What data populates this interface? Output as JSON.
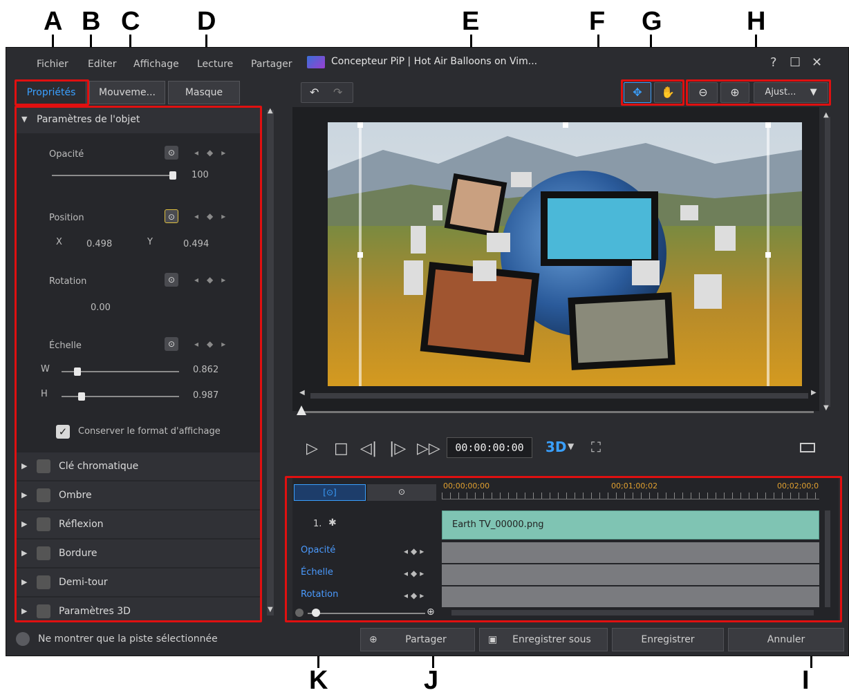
{
  "callouts": [
    "A",
    "B",
    "C",
    "D",
    "E",
    "F",
    "G",
    "H",
    "I",
    "J",
    "K"
  ],
  "menu": [
    "Fichier",
    "Editer",
    "Affichage",
    "Lecture",
    "Partager"
  ],
  "title": "Concepteur PiP | Hot Air Balloons on Vim...",
  "window_controls": {
    "help": "?",
    "maximize": "☐",
    "close": "✕"
  },
  "tabs": [
    "Propriétés",
    "Mouveme...",
    "Masque"
  ],
  "object_params": {
    "header": "Paramètres de l'objet",
    "opacity_label": "Opacité",
    "opacity_value": "100",
    "opacity_level": 100,
    "position_label": "Position",
    "x_label": "X",
    "x_value": "0.498",
    "y_label": "Y",
    "y_value": "0.494",
    "rotation_label": "Rotation",
    "rotation_value": "0.00",
    "scale_label": "Échelle",
    "w_label": "W",
    "w_value": "0.862",
    "h_label": "H",
    "h_value": "0.987",
    "keep_ratio_label": "Conserver le format d'affichage"
  },
  "sections": [
    "Clé chromatique",
    "Ombre",
    "Réflexion",
    "Bordure",
    "Demi-tour",
    "Paramètres 3D"
  ],
  "zoom_fit_label": "Ajust...",
  "timecode": "00:00:00:00",
  "view_mode": "3D",
  "timeline": {
    "ruler": [
      "00;00;00;00",
      "00;01;00;02",
      "00;02;00;0"
    ],
    "track_number": "1.",
    "clip_name": "Earth TV_00000.png",
    "rows": [
      "Opacité",
      "Échelle",
      "Rotation"
    ]
  },
  "show_selected_only_label": "Ne montrer que la piste sélectionnée",
  "buttons": {
    "share": "Partager",
    "save_as": "Enregistrer sous",
    "save": "Enregistrer",
    "cancel": "Annuler"
  },
  "colors": {
    "accent": "#3aa0ff",
    "callout_box": "#e01010",
    "timeline_clip": "#7fc4b3"
  }
}
